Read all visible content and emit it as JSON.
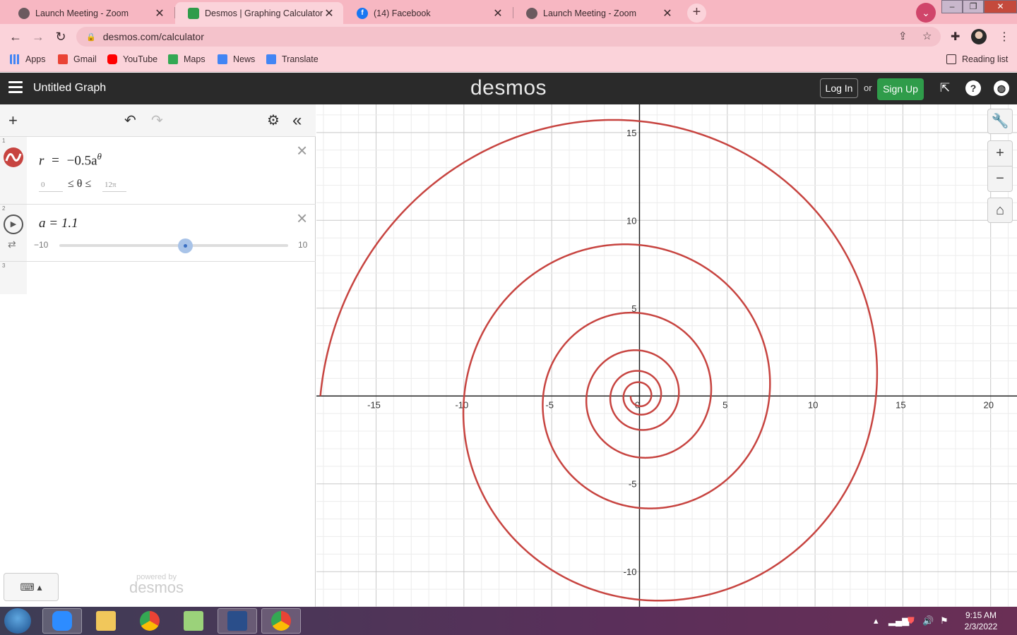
{
  "browser": {
    "tabs": [
      {
        "title": "Launch Meeting - Zoom",
        "active": false
      },
      {
        "title": "Desmos | Graphing Calculator",
        "active": true
      },
      {
        "title": "(14) Facebook",
        "active": false
      },
      {
        "title": "Launch Meeting - Zoom",
        "active": false
      }
    ],
    "close_glyph": "✕",
    "new_tab_glyph": "+",
    "url": "desmos.com/calculator",
    "bookmarks": [
      {
        "label": "Apps",
        "icon": "apps-grid-icon",
        "color": "#4285f4"
      },
      {
        "label": "Gmail",
        "icon": "gmail-icon",
        "color": "#ea4335"
      },
      {
        "label": "YouTube",
        "icon": "youtube-icon",
        "color": "#ff0000"
      },
      {
        "label": "Maps",
        "icon": "maps-icon",
        "color": "#34a853"
      },
      {
        "label": "News",
        "icon": "news-icon",
        "color": "#4285f4"
      },
      {
        "label": "Translate",
        "icon": "translate-icon",
        "color": "#4285f4"
      }
    ],
    "reading_list": "Reading list"
  },
  "desmos": {
    "graph_title": "Untitled Graph",
    "logo": "desmos",
    "login": "Log In",
    "or": "or",
    "signup": "Sign Up",
    "expressions": [
      {
        "index": "1",
        "lhs": "r",
        "eq": "=",
        "rhs": "−0.5a",
        "sup": "θ",
        "domain_min": "0",
        "domain_mid": "≤ θ ≤",
        "domain_max": "12π",
        "color": "#c74440"
      },
      {
        "index": "2",
        "text": "a = 1.1",
        "slider_min": "−10",
        "slider_max": "10",
        "slider_value": 1.1
      },
      {
        "index": "3"
      }
    ],
    "powered_by": "powered by",
    "powered_logo": "desmos"
  },
  "chart_data": {
    "type": "line",
    "curve": "polar",
    "equation": "r = −0.5a^θ",
    "parameter": {
      "a": 1.1
    },
    "theta_range": [
      0,
      37.699
    ],
    "xlim": [
      -18.4,
      21.5
    ],
    "ylim": [
      -12.0,
      16.6
    ],
    "x_ticks": [
      -15,
      -10,
      -5,
      0,
      5,
      10,
      15,
      20
    ],
    "y_ticks": [
      -10,
      -5,
      5,
      10,
      15
    ],
    "x_tick_labels": [
      "-15",
      "-10",
      "-5",
      "0",
      "5",
      "10",
      "15",
      "20"
    ],
    "y_tick_labels": [
      "-10",
      "-5",
      "5",
      "10",
      "15"
    ],
    "grid": true,
    "color": "#c74440"
  },
  "taskbar": {
    "time": "9:15 AM",
    "date": "2/3/2022"
  }
}
